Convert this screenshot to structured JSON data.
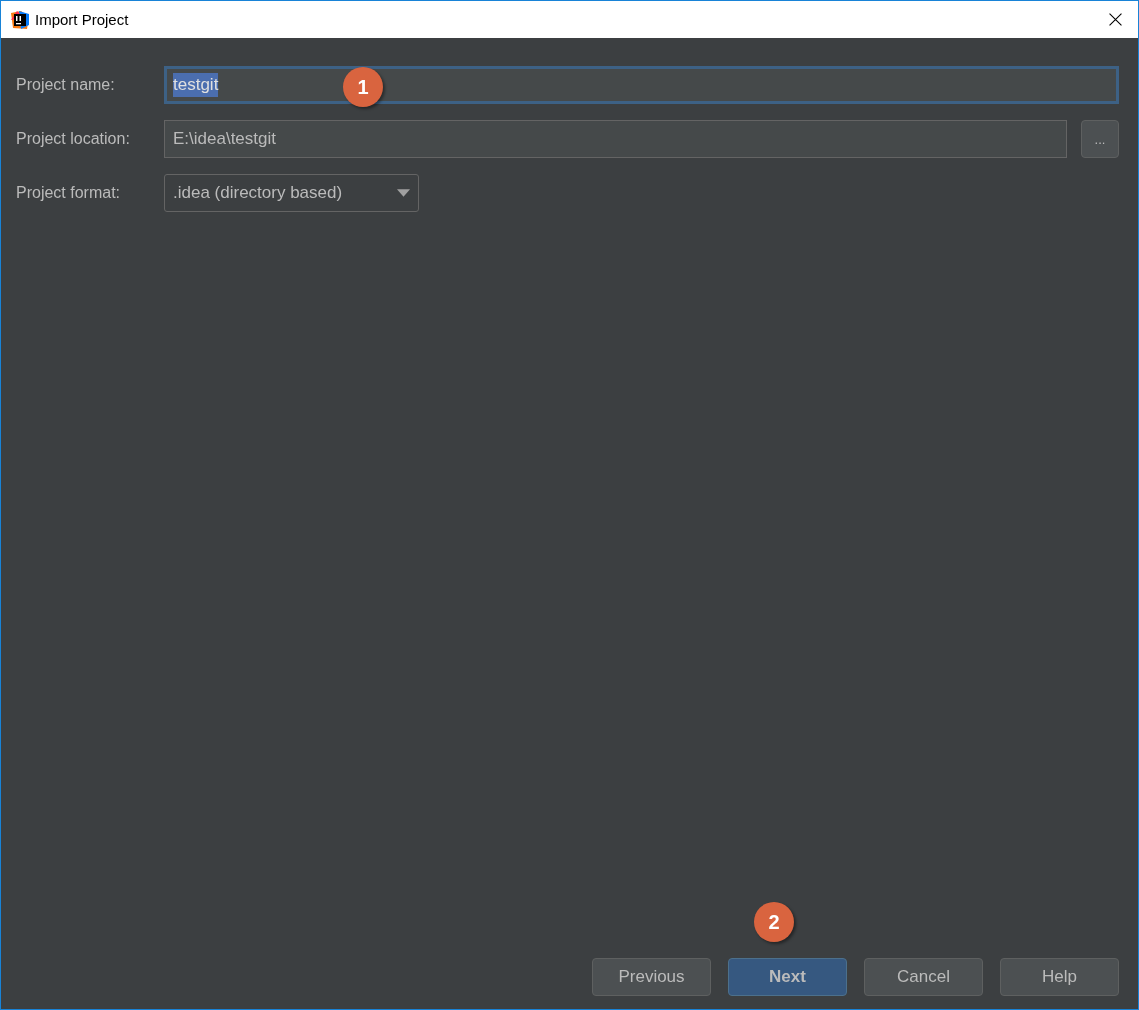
{
  "window": {
    "title": "Import Project"
  },
  "fields": [
    {
      "kind": "text",
      "label": "Project name:",
      "value": "testgit",
      "focused": true,
      "selected": true,
      "marker": "1"
    },
    {
      "kind": "browse",
      "label": "Project location:",
      "value": "E:\\idea\\testgit",
      "focused": false,
      "selected": false,
      "button": "..."
    },
    {
      "kind": "dropdown",
      "label": "Project format:",
      "value": ".idea (directory based)",
      "focused": false,
      "selected": false
    }
  ],
  "buttons": [
    {
      "label": "Previous",
      "default": false
    },
    {
      "label": "Next",
      "default": true,
      "marker": "2"
    },
    {
      "label": "Cancel",
      "default": false
    },
    {
      "label": "Help",
      "default": false
    }
  ]
}
